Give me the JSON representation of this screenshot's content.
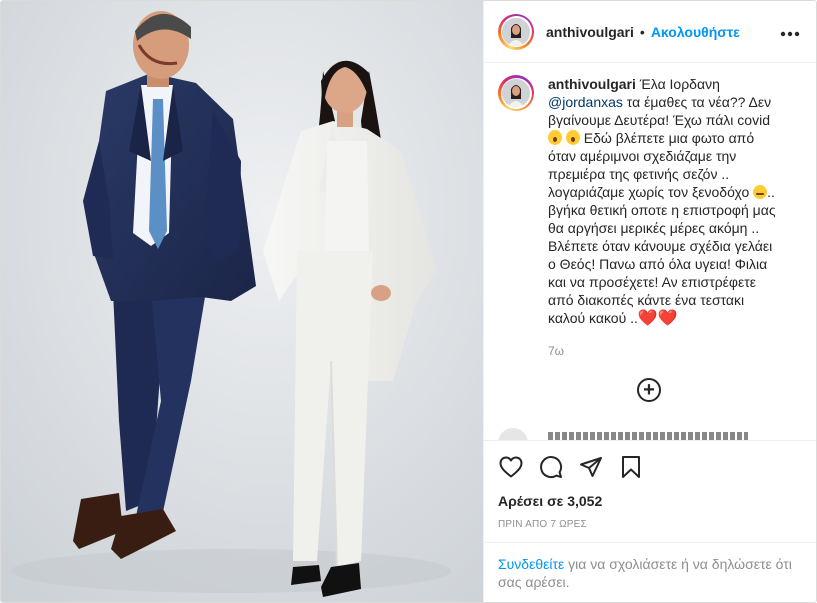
{
  "header": {
    "username": "anthivoulgari",
    "separator": "•",
    "follow_label": "Ακολουθήστε",
    "more_icon": "more-options-icon"
  },
  "caption": {
    "username": "anthivoulgari",
    "text_1": " Έλα Ιορδανη ",
    "mention": "@jordanxas",
    "text_2": " τα έμαθες τα νέα?? Δεν βγαίνουμε Δευτέρα! Έχω πάλι covid ",
    "text_3": " Εδώ βλέπετε μια φωτο από όταν αμέριμνοι σχεδιάζαμε την πρεμιέρα της φετινής σεζόν .. λογαριάζαμε χωρίς τον ξενοδόχο ",
    "text_4": ".. βγήκα θετική οποτε η επιστροφή μας θα αργήσει μερικές μέρες ακόμη .. Βλέπετε όταν κάνουμε σχέδια γελάει ο Θεός! Πανω από όλα υγεια! Φιλια και να προσέχετε! Αν επιστρέφετε από διακοπές κάντε ένα τεστακι καλού κακού ..",
    "hearts": "❤️❤️",
    "time": "7ω"
  },
  "load_more_label": "+",
  "actions": {
    "like_icon": "heart-icon",
    "comment_icon": "comment-icon",
    "share_icon": "share-icon",
    "save_icon": "bookmark-icon"
  },
  "likes": "Αρέσει σε 3,052",
  "posted_ago": "ΠΡΙΝ ΑΠΟ 7 ΩΡΕΣ",
  "login": {
    "link": "Συνδεθείτε",
    "rest": " για να σχολιάσετε ή να δηλώσετε ότι σας αρέσει."
  },
  "colors": {
    "accent": "#0095f6",
    "heart": "#e0245e",
    "muted": "#8e8e8e"
  }
}
